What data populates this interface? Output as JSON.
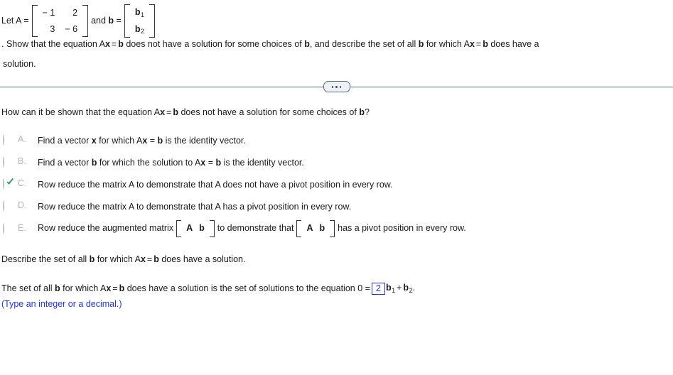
{
  "problem": {
    "let_label": "Let A =",
    "matrix_a": {
      "rows": [
        [
          "− 1",
          "2"
        ],
        [
          "3",
          "− 6"
        ]
      ]
    },
    "and_label": "and b =",
    "vector_b": {
      "rows": [
        [
          "b₁"
        ],
        [
          "b₂"
        ]
      ],
      "entry_1_base": "b",
      "entry_1_sub": "1",
      "entry_2_base": "b",
      "entry_2_sub": "2"
    },
    "statement_part1": ". Show that the equation A",
    "statement_x": "x",
    "statement_eq": "=",
    "statement_b": "b",
    "statement_part2": " does not have a solution for some choices of ",
    "statement_b2": "b",
    "statement_part3": ", and describe the set of all ",
    "statement_b3": "b",
    "statement_part4": " for which A",
    "statement_x2": "x",
    "statement_eq2": "=",
    "statement_b4": "b",
    "statement_part5": " does have a",
    "statement_tail": "solution."
  },
  "divider": {
    "ellipsis_label": "..."
  },
  "question": {
    "part1": "How can it be shown that the equation A",
    "x": "x",
    "eq": "=",
    "b": "b",
    "part2": " does not have a solution for some choices of ",
    "b2": "b",
    "part3": "?"
  },
  "choices": [
    {
      "letter": "A.",
      "selected": false,
      "type": "plain",
      "segments": [
        {
          "t": "Find a vector ",
          "b": false
        },
        {
          "t": "x",
          "b": true
        },
        {
          "t": " for which A",
          "b": false
        },
        {
          "t": "x",
          "b": true
        },
        {
          "t": " = ",
          "b": false
        },
        {
          "t": "b",
          "b": true
        },
        {
          "t": " is the identity vector.",
          "b": false
        }
      ]
    },
    {
      "letter": "B.",
      "selected": false,
      "type": "plain",
      "segments": [
        {
          "t": "Find a vector ",
          "b": false
        },
        {
          "t": "b",
          "b": true
        },
        {
          "t": " for which the solution to A",
          "b": false
        },
        {
          "t": "x",
          "b": true
        },
        {
          "t": " = ",
          "b": false
        },
        {
          "t": "b",
          "b": true
        },
        {
          "t": " is the identity vector.",
          "b": false
        }
      ]
    },
    {
      "letter": "C.",
      "selected": true,
      "type": "plain",
      "segments": [
        {
          "t": "Row reduce the matrix A to demonstrate that A does not have a pivot position in every row.",
          "b": false
        }
      ]
    },
    {
      "letter": "D.",
      "selected": false,
      "type": "plain",
      "segments": [
        {
          "t": "Row reduce the matrix A to demonstrate that A has a pivot position in every row.",
          "b": false
        }
      ]
    },
    {
      "letter": "E.",
      "selected": false,
      "type": "matrix",
      "text_before": "Row reduce the augmented matrix",
      "matrix_1": [
        "A",
        "b"
      ],
      "text_middle": "to demonstrate that",
      "matrix_2": [
        "A",
        "b"
      ],
      "text_after": "has a pivot position in every row."
    }
  ],
  "describe": {
    "part1": "Describe the set of all ",
    "b": "b",
    "part2": " for which A",
    "x": "x",
    "eq": "=",
    "b2": "b",
    "part3": " does have a solution."
  },
  "answer": {
    "part1": "The set of all ",
    "b": "b",
    "part2": " for which A",
    "x": "x",
    "eq": "=",
    "b2": "b",
    "part3": " does have a solution is the set of solutions to the equation 0 =",
    "input_value": "2",
    "term1_base": "b",
    "term1_sub": "1",
    "plus": "+",
    "term2_base": "b",
    "term2_sub": "2",
    "period": ".",
    "hint": "(Type an integer or a decimal.)"
  },
  "colors": {
    "answer_blue": "#2733d6",
    "check_green": "#1f9b4e",
    "radio_grey": "#c2c2c2",
    "letter_grey": "#b6b6b6",
    "divider": "#5b6b7d"
  }
}
